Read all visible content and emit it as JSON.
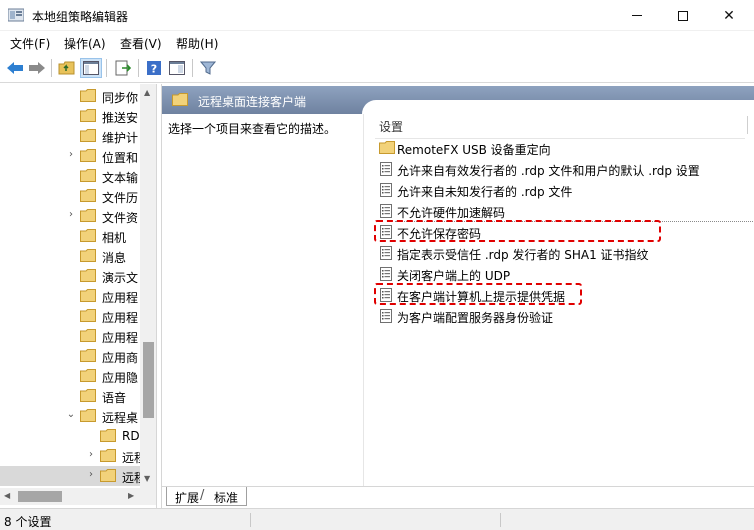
{
  "window": {
    "title": "本地组策略编辑器",
    "controls": {
      "minimize": "—",
      "maximize": "□",
      "close": "✕"
    }
  },
  "menu": [
    "文件(F)",
    "操作(A)",
    "查看(V)",
    "帮助(H)"
  ],
  "toolbar": {
    "icons": [
      "back-arrow-icon",
      "forward-arrow-icon",
      "up-folder-icon",
      "show-hide-tree-icon",
      "export-list-icon",
      "help-icon",
      "properties-view-icon",
      "filter-icon"
    ]
  },
  "tree": {
    "items": [
      {
        "label": "同步你",
        "expandable": false,
        "indent": 0
      },
      {
        "label": "推送安",
        "expandable": false,
        "indent": 0
      },
      {
        "label": "维护计",
        "expandable": false,
        "indent": 0
      },
      {
        "label": "位置和",
        "expandable": true,
        "indent": 0
      },
      {
        "label": "文本输",
        "expandable": false,
        "indent": 0
      },
      {
        "label": "文件历",
        "expandable": false,
        "indent": 0
      },
      {
        "label": "文件资",
        "expandable": true,
        "indent": 0
      },
      {
        "label": "相机",
        "expandable": false,
        "indent": 0
      },
      {
        "label": "消息",
        "expandable": false,
        "indent": 0
      },
      {
        "label": "演示文",
        "expandable": false,
        "indent": 0
      },
      {
        "label": "应用程",
        "expandable": false,
        "indent": 0
      },
      {
        "label": "应用程",
        "expandable": false,
        "indent": 0
      },
      {
        "label": "应用程",
        "expandable": false,
        "indent": 0
      },
      {
        "label": "应用商",
        "expandable": false,
        "indent": 0
      },
      {
        "label": "应用隐",
        "expandable": false,
        "indent": 0
      },
      {
        "label": "语音",
        "expandable": false,
        "indent": 0
      },
      {
        "label": "远程桌",
        "expandable": true,
        "expanded": true,
        "indent": 0
      },
      {
        "label": "RD",
        "expandable": false,
        "indent": 1
      },
      {
        "label": "远程",
        "expandable": true,
        "indent": 1
      },
      {
        "label": "远程",
        "expandable": true,
        "indent": 1,
        "selected": true
      }
    ]
  },
  "pane": {
    "title": "远程桌面连接客户端",
    "description": "选择一个项目来查看它的描述。",
    "column_header": "设置",
    "settings": [
      {
        "label": "RemoteFX USB 设备重定向",
        "icon": "folder-icon"
      },
      {
        "label": "允许来自有效发行者的 .rdp 文件和用户的默认 .rdp 设置",
        "icon": "policy-setting-icon"
      },
      {
        "label": "允许来自未知发行者的 .rdp 文件",
        "icon": "policy-setting-icon"
      },
      {
        "label": "不允许硬件加速解码",
        "icon": "policy-setting-icon"
      },
      {
        "label": "不允许保存密码",
        "icon": "policy-setting-icon",
        "highlighted": true
      },
      {
        "label": "指定表示受信任 .rdp 发行者的 SHA1 证书指纹",
        "icon": "policy-setting-icon"
      },
      {
        "label": "关闭客户端上的 UDP",
        "icon": "policy-setting-icon"
      },
      {
        "label": "在客户端计算机上提示提供凭据",
        "icon": "policy-setting-icon",
        "highlighted": true
      },
      {
        "label": "为客户端配置服务器身份验证",
        "icon": "policy-setting-icon"
      }
    ],
    "tabs": [
      "扩展",
      "标准"
    ],
    "active_tab": "扩展"
  },
  "status": {
    "text": "8 个设置"
  },
  "colors": {
    "highlight": "#e00000",
    "header": "#7e8fa8",
    "folder": "#e8c25a"
  }
}
